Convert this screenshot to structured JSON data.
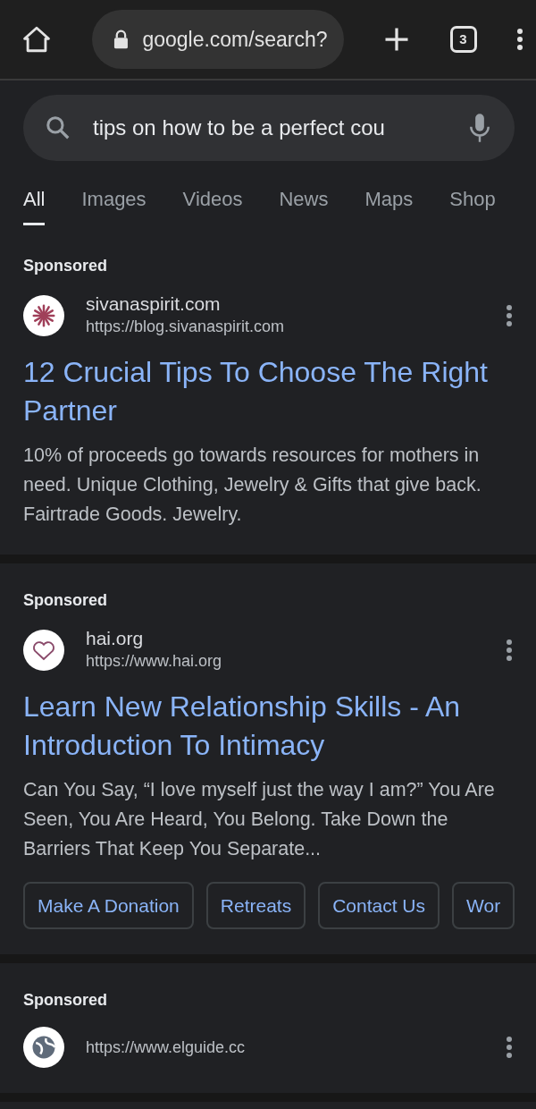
{
  "toolbar": {
    "url": "google.com/search?",
    "tab_count": "3"
  },
  "search": {
    "value": "tips on how to be a perfect cou"
  },
  "tabs": [
    {
      "label": "All",
      "selected": true
    },
    {
      "label": "Images",
      "selected": false
    },
    {
      "label": "Videos",
      "selected": false
    },
    {
      "label": "News",
      "selected": false
    },
    {
      "label": "Maps",
      "selected": false
    },
    {
      "label": "Shop",
      "selected": false
    }
  ],
  "ads": [
    {
      "label": "Sponsored",
      "site": "sivanaspirit.com",
      "url": "https://blog.sivanaspirit.com",
      "title": "12 Crucial Tips To Choose The Right Partner",
      "description": "10% of proceeds go towards resources for mothers in need. Unique Clothing, Jewelry & Gifts that give back. Fairtrade Goods. Jewelry."
    },
    {
      "label": "Sponsored",
      "site": "hai.org",
      "url": "https://www.hai.org",
      "title": "Learn New Relationship Skills - An Introduction To Intimacy",
      "description": "Can You Say, “I love myself just the way I am?” You Are Seen, You Are Heard, You Belong. Take Down the Barriers That Keep You Separate...",
      "sitelinks": [
        "Make A Donation",
        "Retreats",
        "Contact Us",
        "Wor"
      ]
    },
    {
      "label": "Sponsored",
      "url": "https://www.elguide.cc"
    }
  ]
}
